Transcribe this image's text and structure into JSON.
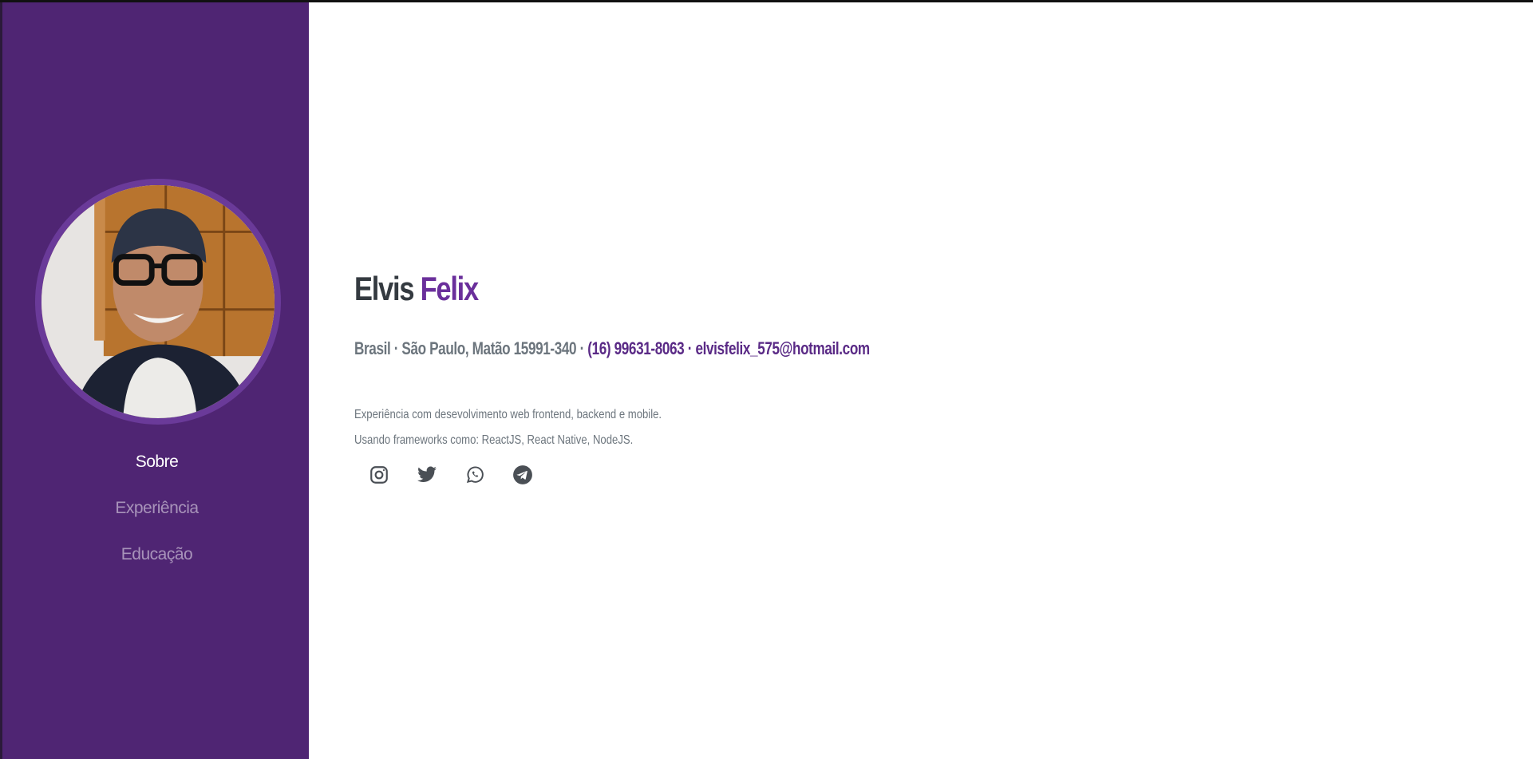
{
  "nav": {
    "items": [
      {
        "label": "Sobre",
        "active": true
      },
      {
        "label": "Experiência",
        "active": false
      },
      {
        "label": "Educação",
        "active": false
      }
    ]
  },
  "profile": {
    "first_name": "Elvis",
    "last_name": "Felix",
    "location": "Brasil · São Paulo, Matão 15991-340 ·",
    "phone": "(16) 99631-8063",
    "separator": "·",
    "email": "elvisfelix_575@hotmail.com",
    "bio_line1": "Experiência com desevolvimento web frontend, backend e mobile.",
    "bio_line2": "Usando frameworks como: ReactJS, React Native, NodeJS."
  },
  "social": {
    "icons": [
      "instagram-icon",
      "twitter-icon",
      "whatsapp-icon",
      "telegram-icon"
    ]
  },
  "colors": {
    "sidebar": "#4f2573",
    "accent": "#6a2f9b",
    "text": "#343a40",
    "muted": "#6c757d"
  }
}
